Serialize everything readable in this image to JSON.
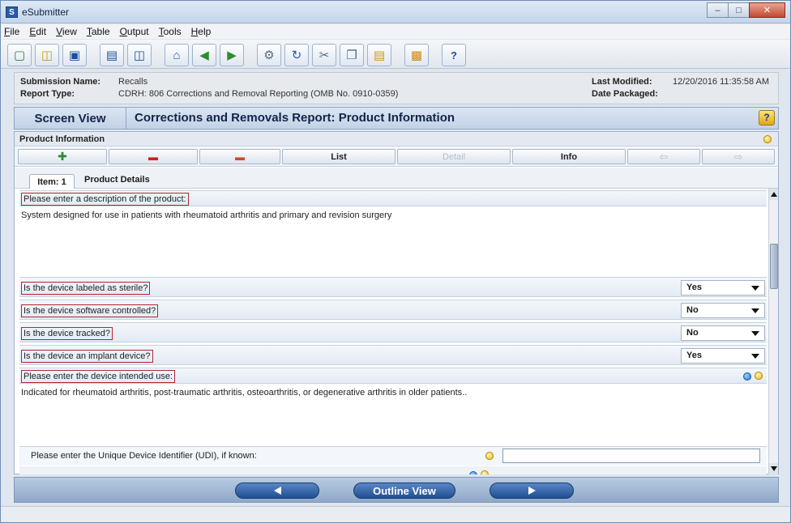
{
  "window": {
    "title": "eSubmitter",
    "app_icon_letter": "S"
  },
  "window_controls": {
    "minimize": "–",
    "maximize": "□",
    "close": "✕"
  },
  "menu": [
    "File",
    "Edit",
    "View",
    "Table",
    "Output",
    "Tools",
    "Help"
  ],
  "toolbar": {
    "buttons": [
      {
        "icon": "new-document-icon",
        "glyph": "📄"
      },
      {
        "icon": "open-folder-icon",
        "glyph": "📂"
      },
      {
        "icon": "save-icon",
        "glyph": "💾"
      },
      {
        "icon": "screen-view-icon",
        "glyph": "▭"
      },
      {
        "icon": "split-view-icon",
        "glyph": "◫"
      },
      {
        "icon": "home-icon",
        "glyph": "⌂"
      },
      {
        "icon": "back-icon",
        "glyph": "◀"
      },
      {
        "icon": "forward-icon",
        "glyph": "▶"
      },
      {
        "icon": "settings-icon",
        "glyph": "⚙"
      },
      {
        "icon": "refresh-icon",
        "glyph": "↻"
      },
      {
        "icon": "cut-icon",
        "glyph": "✂"
      },
      {
        "icon": "copy-icon",
        "glyph": "⎘"
      },
      {
        "icon": "paste-icon",
        "glyph": "📋"
      },
      {
        "icon": "package-icon",
        "glyph": "📦"
      },
      {
        "icon": "help-icon",
        "glyph": "?"
      }
    ]
  },
  "submission": {
    "name_label": "Submission Name:",
    "name_value": "Recalls",
    "type_label": "Report Type:",
    "type_value": "CDRH: 806 Corrections and Removal Reporting (OMB No. 0910-0359)",
    "modified_label": "Last Modified:",
    "modified_value": "12/20/2016 11:35:58 AM",
    "packaged_label": "Date Packaged:",
    "packaged_value": ""
  },
  "screen": {
    "view_tab": "Screen View",
    "title": "Corrections and Removals Report: Product Information",
    "help_glyph": "?"
  },
  "section": {
    "title": "Product Information"
  },
  "nav": {
    "add": {
      "icon": "add-icon",
      "glyph": "✚"
    },
    "remove": {
      "icon": "remove-icon",
      "glyph": "▬"
    },
    "erase": {
      "icon": "eraser-icon",
      "glyph": "▬"
    },
    "list_label": "List",
    "detail_label": "Detail",
    "info_label": "Info",
    "prev": {
      "icon": "prev-arrow-icon",
      "glyph": "⇦"
    },
    "next": {
      "icon": "next-arrow-icon",
      "glyph": "⇨"
    }
  },
  "item": {
    "label": "Item: 1",
    "title": "Product Details"
  },
  "questions": {
    "description": {
      "label": "Please enter a description of the product:",
      "answer": "System designed for use in patients with rheumatoid arthritis and primary and revision surgery"
    },
    "sterile": {
      "label": "Is the device labeled as sterile?",
      "value": "Yes"
    },
    "software": {
      "label": "Is the device software controlled?",
      "value": "No"
    },
    "tracked": {
      "label": "Is the device tracked?",
      "value": "No"
    },
    "implant": {
      "label": "Is the device an implant device?",
      "value": "Yes"
    },
    "intended_use": {
      "label": "Please enter the device intended use:",
      "answer": "Indicated for rheumatoid arthritis, post-traumatic arthritis, osteoarthritis, or degenerative arthritis in older patients.."
    },
    "udi": {
      "label": "Please enter the Unique Device Identifier (UDI), if known:",
      "value": ""
    }
  },
  "bottom": {
    "outline_label": "Outline View"
  },
  "colors": {
    "highlight_border": "#b3262e",
    "accent": "#1f4f93"
  }
}
